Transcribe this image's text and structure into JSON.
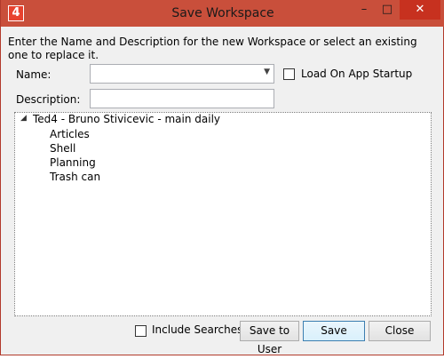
{
  "window": {
    "title": "Save Workspace",
    "app_icon_text": "4",
    "min_glyph": "–",
    "max_glyph": "□",
    "close_glyph": "✕"
  },
  "form": {
    "instructions": "Enter the Name and Description for the new Workspace or select an existing one to replace it.",
    "name_label": "Name:",
    "name_value": "",
    "description_label": "Description:",
    "description_value": "",
    "load_on_startup_label": "Load On App Startup",
    "load_on_startup_checked": false
  },
  "tree": {
    "root": "Ted4 - Bruno Stivicevic - main daily",
    "expanded": true,
    "children": [
      "Articles",
      "Shell",
      "Planning",
      "Trash can"
    ]
  },
  "footer": {
    "include_searches_label": "Include Searches",
    "include_searches_checked": false,
    "save_to_user_label": "Save to User",
    "save_label": "Save",
    "close_label": "Close"
  },
  "colors": {
    "titlebar": "#c94f3b",
    "close_button": "#c7311f",
    "background": "#f0f0f0"
  }
}
